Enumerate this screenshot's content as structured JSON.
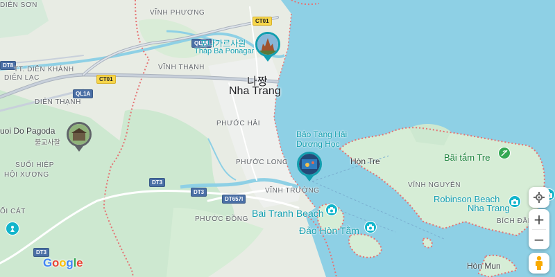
{
  "map": {
    "brand_letters": [
      "G",
      "o",
      "o",
      "g",
      "l",
      "e"
    ],
    "brand_colors": [
      "#4285f4",
      "#ea4335",
      "#fbbc05",
      "#4285f4",
      "#34a853",
      "#ea4335"
    ],
    "colors": {
      "water": "#8ed0e5",
      "land": "#e8ece4",
      "forest": "#cde8d0",
      "urban": "#eef0ee",
      "boundary": "#e57373",
      "accent": "#129eaf"
    }
  },
  "labels": {
    "dien_son": "DIÊN SƠN",
    "vinh_phuong": "VĨNH PHƯƠNG",
    "dien_khanh": "TT. DIÊN KHÁNH",
    "dien_lac": "DIÊN LẠC",
    "vinh_thanh": "VĨNH THẠNH",
    "dien_thanh": "DIÊN THẠNH",
    "phuoc_hai": "PHƯỚC HẢI",
    "phuoc_long": "PHƯỚC LONG",
    "vinh_truong": "VĨNH TRƯỜNG",
    "suoi_hiep": "SUỐI HIỆP",
    "hoi_xuong": "HỘI XƯƠNG",
    "oi_cat": "ỐI CÁT",
    "phuoc_dong": "PHƯỚC ĐỒNG",
    "vinh_nguyen": "VĨNH NGUYÊN",
    "bich_dam": "BÍCH ĐẦM",
    "city_ko": "나짱",
    "city": "Nha Trang",
    "ponagar_ko": "포나가르사원",
    "ponagar": "Tháp Bà Ponagar",
    "museum": "Bảo Tàng Hải Dương Học",
    "pagoda": "uoi Do Pagoda",
    "pagoda_ko": "불교사찰",
    "bai_tranh": "Bai Tranh Beach",
    "dao_hon_tam": "Đảo Hòn Tằm",
    "hon_tre": "Hòn Tre",
    "bai_tam_tre": "Bãi tắm Tre",
    "robinson_1": "Robinson Beach",
    "robinson_2": "Nha Trang",
    "hon_mun": "Hòn Mun"
  },
  "roads": {
    "ct01_a": "CT01",
    "ct01_b": "CT01",
    "ql1a_a": "QL1A",
    "ql1a_b": "QL1A",
    "dt8": "DT8",
    "dt3_a": "DT3",
    "dt3_b": "DT3",
    "dt3_c": "DT3",
    "dt657": "DT657I"
  },
  "controls": {
    "locate_icon": "target-icon",
    "zoom_in": "+",
    "zoom_out": "−",
    "pegman_icon": "pegman-icon"
  }
}
